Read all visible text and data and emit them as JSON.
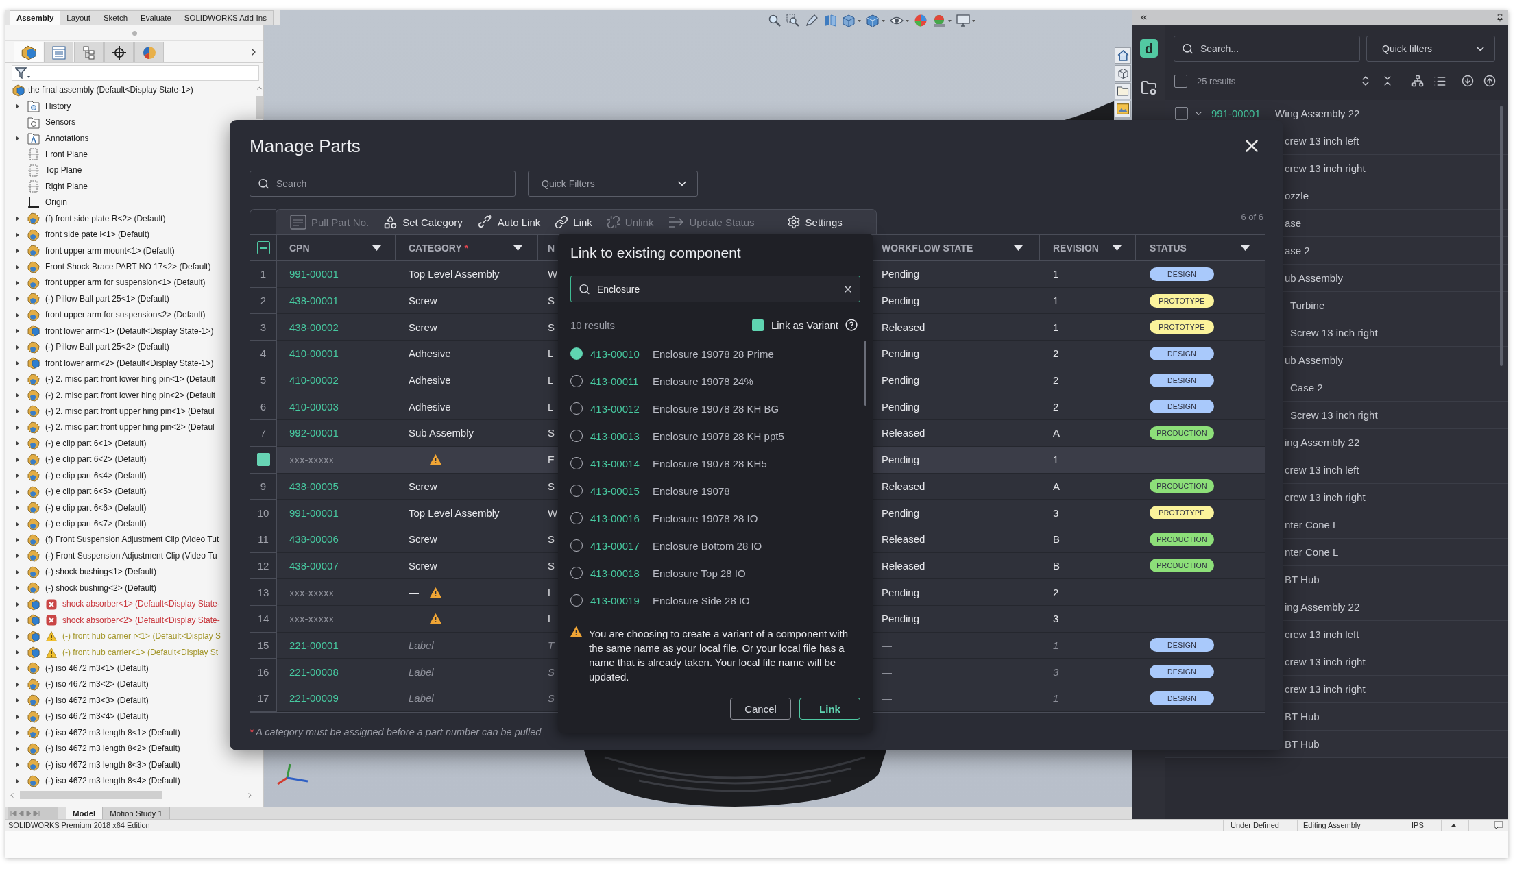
{
  "command_tabs": [
    {
      "label": "Assembly",
      "selected": true
    },
    {
      "label": "Layout",
      "selected": false
    },
    {
      "label": "Sketch",
      "selected": false
    },
    {
      "label": "Evaluate",
      "selected": false
    },
    {
      "label": "SOLIDWORKS Add-Ins",
      "selected": false
    }
  ],
  "feature_manager": {
    "tabs": [
      {
        "kind": "feature_tree",
        "selected": true
      },
      {
        "kind": "property_manager",
        "selected": false
      },
      {
        "kind": "configuration_manager",
        "selected": false
      },
      {
        "kind": "dimxpert",
        "selected": false
      },
      {
        "kind": "display_manager",
        "selected": false
      }
    ],
    "tree": {
      "label": "the final assembly (Default<Display State-1>)",
      "kind": "assembly",
      "children": [
        {
          "label": "History",
          "kind": "history",
          "expandable": true
        },
        {
          "label": "Sensors",
          "kind": "sensors",
          "expandable": false
        },
        {
          "label": "Annotations",
          "kind": "annotations",
          "expandable": true
        },
        {
          "label": "Front Plane",
          "kind": "plane",
          "expandable": false
        },
        {
          "label": "Top Plane",
          "kind": "plane",
          "expandable": false
        },
        {
          "label": "Right Plane",
          "kind": "plane",
          "expandable": false
        },
        {
          "label": "Origin",
          "kind": "origin",
          "expandable": false
        },
        {
          "label": "(f) front side plate R<2> (Default)",
          "kind": "part",
          "expandable": true
        },
        {
          "label": "front side pate l<1> (Default)",
          "kind": "part",
          "expandable": true
        },
        {
          "label": "front upper arm mount<1> (Default)",
          "kind": "part",
          "expandable": true
        },
        {
          "label": "Front Shock Brace PART NO 17<2> (Default)",
          "kind": "part",
          "expandable": true
        },
        {
          "label": "front upper arm for suspension<1> (Default)",
          "kind": "part",
          "expandable": true
        },
        {
          "label": "(-) Pillow Ball part 25<1> (Default)",
          "kind": "part",
          "expandable": true
        },
        {
          "label": "front upper arm for suspension<2> (Default)",
          "kind": "part",
          "expandable": true
        },
        {
          "label": "front lower arm<1> (Default<Display State-1>)",
          "kind": "assembly",
          "expandable": true
        },
        {
          "label": "(-) Pillow Ball part 25<2> (Default)",
          "kind": "part",
          "expandable": true
        },
        {
          "label": "front lower arm<2> (Default<Display State-1>)",
          "kind": "assembly",
          "expandable": true
        },
        {
          "label": "(-) 2. misc part front lower hing pin<1> (Default",
          "kind": "part",
          "expandable": true
        },
        {
          "label": "(-) 2. misc part front lower hing pin<2> (Default",
          "kind": "part",
          "expandable": true
        },
        {
          "label": "(-) 2. misc part front upper hing pin<1> (Defaul",
          "kind": "part",
          "expandable": true
        },
        {
          "label": "(-) 2. misc part front upper hing pin<2> (Defaul",
          "kind": "part",
          "expandable": true
        },
        {
          "label": "(-) e clip part 6<1> (Default)",
          "kind": "part",
          "expandable": true
        },
        {
          "label": "(-) e clip part 6<2> (Default)",
          "kind": "part",
          "expandable": true
        },
        {
          "label": "(-) e clip part 6<4> (Default)",
          "kind": "part",
          "expandable": true
        },
        {
          "label": "(-) e clip part 6<5> (Default)",
          "kind": "part",
          "expandable": true
        },
        {
          "label": "(-) e clip part 6<6> (Default)",
          "kind": "part",
          "expandable": true
        },
        {
          "label": "(-) e clip part 6<7> (Default)",
          "kind": "part",
          "expandable": true
        },
        {
          "label": "(f) Front Suspension Adjustment Clip (Video Tut",
          "kind": "part",
          "expandable": true
        },
        {
          "label": "(-) Front Suspension Adjustment Clip (Video Tu",
          "kind": "part",
          "expandable": true
        },
        {
          "label": "(-) shock bushing<1> (Default)",
          "kind": "part",
          "expandable": true
        },
        {
          "label": "(-) shock bushing<2> (Default)",
          "kind": "part",
          "expandable": true
        },
        {
          "label": "shock absorber<1> (Default<Display State-",
          "kind": "assembly_error",
          "expandable": true
        },
        {
          "label": "shock absorber<2> (Default<Display State-",
          "kind": "assembly_error",
          "expandable": true
        },
        {
          "label": "(-) front hub carrier r<1> (Default<Display S",
          "kind": "assembly_warning",
          "expandable": true
        },
        {
          "label": "(-) front hub carrier<1> (Default<Display St",
          "kind": "assembly_warning",
          "expandable": true
        },
        {
          "label": "(-) iso 4672 m3<1> (Default)",
          "kind": "part",
          "expandable": true
        },
        {
          "label": "(-) iso 4672 m3<2> (Default)",
          "kind": "part",
          "expandable": true
        },
        {
          "label": "(-) iso 4672 m3<3> (Default)",
          "kind": "part",
          "expandable": true
        },
        {
          "label": "(-) iso 4672 m3<4> (Default)",
          "kind": "part",
          "expandable": true
        },
        {
          "label": "(-) iso 4672 m3 length 8<1> (Default)",
          "kind": "part",
          "expandable": true
        },
        {
          "label": "(-) iso 4672 m3 length 8<2> (Default)",
          "kind": "part",
          "expandable": true
        },
        {
          "label": "(-) iso 4672 m3 length 8<3> (Default)",
          "kind": "part",
          "expandable": true
        },
        {
          "label": "(-) iso 4672 m3 length 8<4> (Default)",
          "kind": "part",
          "expandable": true
        }
      ]
    }
  },
  "document_tabs": [
    {
      "label": "Model",
      "selected": true
    },
    {
      "label": "Motion Study 1",
      "selected": false
    }
  ],
  "status_bar": {
    "edition": "SOLIDWORKS Premium 2018 x64 Edition",
    "fields": [
      "Under Defined",
      "Editing Assembly",
      "IPS"
    ]
  },
  "task_pane": {
    "logo": "d",
    "search": {
      "placeholder": "Search..."
    },
    "quick_filters": {
      "placeholder": "Quick filters"
    },
    "select_all": {
      "checked": false
    },
    "result_count": "25 results",
    "tree": [
      {
        "cpn": "991-00001",
        "name": "Wing Assembly 22",
        "checked": false,
        "expanded": true,
        "children": [
          {
            "name": "crew 13 inch left"
          },
          {
            "name": "crew 13 inch right"
          },
          {
            "name": "ozzle"
          },
          {
            "name": "ase"
          },
          {
            "name": "ase 2"
          },
          {
            "name": "ub Assembly",
            "children": [
              {
                "name": "Turbine"
              },
              {
                "name": "Screw 13 inch right"
              }
            ]
          },
          {
            "name": "ub Assembly",
            "children": [
              {
                "name": "Case 2"
              },
              {
                "name": "Screw 13 inch right"
              }
            ]
          },
          {
            "name": "ing Assembly 22"
          },
          {
            "name": "crew 13 inch left"
          },
          {
            "name": "crew 13 inch right"
          },
          {
            "name": "nter Cone L"
          },
          {
            "name": "nter Cone L"
          },
          {
            "name": "BT Hub"
          },
          {
            "name": "ing Assembly 22"
          },
          {
            "name": "crew 13 inch left"
          },
          {
            "name": "crew 13 inch right"
          },
          {
            "name": "crew 13 inch right"
          },
          {
            "name": "BT Hub"
          },
          {
            "name": "BT Hub"
          }
        ]
      }
    ]
  },
  "manage_parts": {
    "title": "Manage Parts",
    "search": {
      "placeholder": "Search"
    },
    "quick_filters": {
      "placeholder": "Quick Filters"
    },
    "toolbar": [
      {
        "label": "Pull Part No.",
        "kind": "pull_part_number",
        "disabled": true
      },
      {
        "label": "Set Category",
        "kind": "set_category",
        "disabled": false
      },
      {
        "label": "Auto Link",
        "kind": "auto_link",
        "disabled": false
      },
      {
        "label": "Link",
        "kind": "link",
        "disabled": false
      },
      {
        "label": "Unlink",
        "kind": "unlink",
        "disabled": true
      },
      {
        "label": "Update Status",
        "kind": "update_status",
        "disabled": true
      },
      {
        "label": "Settings",
        "kind": "settings",
        "disabled": false
      }
    ],
    "page_count": "6 of 6",
    "select_all": {
      "partial": true
    },
    "columns": [
      {
        "label": "CPN",
        "filter": true
      },
      {
        "label": "CATEGORY",
        "marker": "*",
        "filter": true
      },
      {
        "label": "N"
      },
      {
        "label": "WORKFLOW STATE",
        "filter": true
      },
      {
        "label": "REVISION",
        "filter": true
      },
      {
        "label": "STATUS",
        "filter": true
      }
    ],
    "rows": [
      {
        "number": "1",
        "selected": false,
        "kind": "assigned",
        "cpn": "991-00001",
        "category": "Top Level Assembly",
        "column_3": "W",
        "workflow_state": "Pending",
        "revision": "1",
        "status": {
          "label": "DESIGN",
          "color": "#a9c9fb"
        }
      },
      {
        "number": "2",
        "selected": false,
        "kind": "assigned",
        "cpn": "438-00001",
        "category": "Screw",
        "column_3": "S",
        "workflow_state": "Pending",
        "revision": "1",
        "status": {
          "label": "PROTOTYPE",
          "color": "#fbf39b"
        }
      },
      {
        "number": "3",
        "selected": false,
        "kind": "assigned",
        "cpn": "438-00002",
        "category": "Screw",
        "column_3": "S",
        "workflow_state": "Released",
        "revision": "1",
        "status": {
          "label": "PROTOTYPE",
          "color": "#fbf39b"
        }
      },
      {
        "number": "4",
        "selected": false,
        "kind": "assigned",
        "cpn": "410-00001",
        "category": "Adhesive",
        "column_3": "L",
        "workflow_state": "Pending",
        "revision": "2",
        "status": {
          "label": "DESIGN",
          "color": "#a9c9fb"
        }
      },
      {
        "number": "5",
        "selected": false,
        "kind": "assigned",
        "cpn": "410-00002",
        "category": "Adhesive",
        "column_3": "L",
        "workflow_state": "Pending",
        "revision": "2",
        "status": {
          "label": "DESIGN",
          "color": "#a9c9fb"
        }
      },
      {
        "number": "6",
        "selected": false,
        "kind": "assigned",
        "cpn": "410-00003",
        "category": "Adhesive",
        "column_3": "L",
        "workflow_state": "Pending",
        "revision": "2",
        "status": {
          "label": "DESIGN",
          "color": "#a9c9fb"
        }
      },
      {
        "number": "7",
        "selected": false,
        "kind": "assigned",
        "cpn": "992-00001",
        "category": "Sub Assembly",
        "column_3": "S",
        "workflow_state": "Released",
        "revision": "A",
        "status": {
          "label": "PRODUCTION",
          "color": "#8ddf79"
        }
      },
      {
        "selected": true,
        "kind": "uncategorized",
        "cpn": "xxx-xxxxx",
        "category": "—",
        "column_3": "E",
        "workflow_state": "Pending",
        "revision": "1"
      },
      {
        "number": "9",
        "selected": false,
        "kind": "assigned",
        "cpn": "438-00005",
        "category": "Screw",
        "column_3": "S",
        "workflow_state": "Released",
        "revision": "A",
        "status": {
          "label": "PRODUCTION",
          "color": "#8ddf79"
        }
      },
      {
        "number": "10",
        "selected": false,
        "kind": "assigned",
        "cpn": "991-00001",
        "category": "Top Level Assembly",
        "column_3": "W",
        "workflow_state": "Pending",
        "revision": "3",
        "status": {
          "label": "PROTOTYPE",
          "color": "#fbf39b"
        }
      },
      {
        "number": "11",
        "selected": false,
        "kind": "assigned",
        "cpn": "438-00006",
        "category": "Screw",
        "column_3": "S",
        "workflow_state": "Released",
        "revision": "B",
        "status": {
          "label": "PRODUCTION",
          "color": "#8ddf79"
        }
      },
      {
        "number": "12",
        "selected": false,
        "kind": "assigned",
        "cpn": "438-00007",
        "category": "Screw",
        "column_3": "S",
        "workflow_state": "Released",
        "revision": "B",
        "status": {
          "label": "PRODUCTION",
          "color": "#8ddf79"
        }
      },
      {
        "number": "13",
        "selected": false,
        "kind": "uncategorized",
        "cpn": "xxx-xxxxx",
        "category": "—",
        "column_3": "L",
        "workflow_state": "Pending",
        "revision": "2"
      },
      {
        "number": "14",
        "selected": false,
        "kind": "uncategorized",
        "cpn": "xxx-xxxxx",
        "category": "—",
        "column_3": "L",
        "workflow_state": "Pending",
        "revision": "3"
      },
      {
        "number": "15",
        "selected": false,
        "kind": "label_only",
        "cpn": "221-00001",
        "category": "Label",
        "column_3": "T",
        "workflow_state": "—",
        "revision": "1",
        "status": {
          "label": "DESIGN",
          "color": "#a9c9fb"
        }
      },
      {
        "number": "16",
        "selected": false,
        "kind": "label_only",
        "cpn": "221-00008",
        "category": "Label",
        "column_3": "S",
        "workflow_state": "—",
        "revision": "3",
        "status": {
          "label": "DESIGN",
          "color": "#a9c9fb"
        }
      },
      {
        "number": "17",
        "selected": false,
        "kind": "label_only",
        "cpn": "221-00009",
        "category": "Label",
        "column_3": "S",
        "workflow_state": "—",
        "revision": "1",
        "status": {
          "label": "DESIGN",
          "color": "#a9c9fb"
        }
      }
    ],
    "footnote": {
      "marker": "*",
      "text": "A category must be assigned before a part number can be pulled"
    },
    "link_popup": {
      "title": "Link to existing component",
      "search": {
        "value": "Enclosure"
      },
      "result_count": "10 results",
      "link_as_variant": {
        "label": "Link as Variant",
        "checked": true
      },
      "results": [
        {
          "cpn": "413-00010",
          "name": "Enclosure 19078 28 Prime",
          "selected": true
        },
        {
          "cpn": "413-00011",
          "name": "Enclosure 19078 24%",
          "selected": false
        },
        {
          "cpn": "413-00012",
          "name": "Enclosure 19078 28 KH BG",
          "selected": false
        },
        {
          "cpn": "413-00013",
          "name": "Enclosure 19078 28 KH ppt5",
          "selected": false
        },
        {
          "cpn": "413-00014",
          "name": "Enclosure 19078 28 KH5",
          "selected": false
        },
        {
          "cpn": "413-00015",
          "name": "Enclosure 19078",
          "selected": false
        },
        {
          "cpn": "413-00016",
          "name": "Enclosure 19078 28 IO",
          "selected": false
        },
        {
          "cpn": "413-00017",
          "name": "Enclosure Bottom 28 IO",
          "selected": false
        },
        {
          "cpn": "413-00018",
          "name": "Enclosure Top 28 IO",
          "selected": false
        },
        {
          "cpn": "413-00019",
          "name": "Enclosure Side 28 IO",
          "selected": false
        }
      ],
      "warning": "You are choosing to create a variant of a component with the same name as your local file. Or your local file has a name that is already taken. Your local file name will be updated.",
      "buttons": [
        {
          "label": "Cancel",
          "kind": "secondary"
        },
        {
          "label": "Link",
          "kind": "primary"
        }
      ]
    }
  }
}
